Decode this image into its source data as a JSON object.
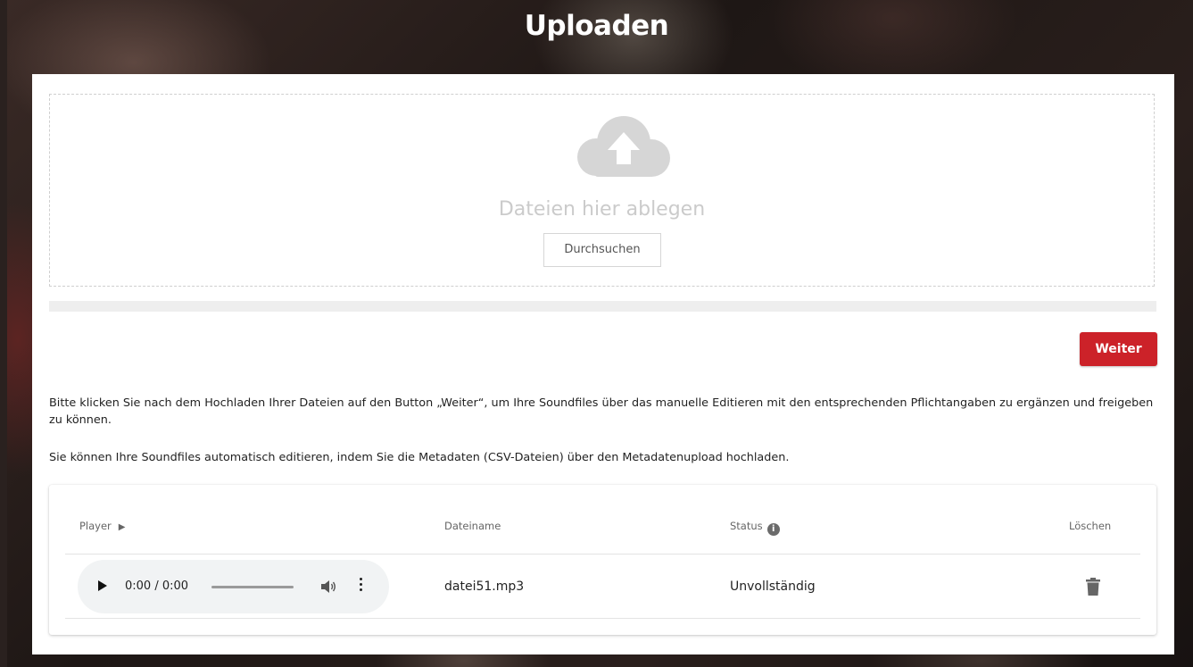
{
  "page": {
    "title": "Uploaden"
  },
  "dropzone": {
    "icon": "cloud-upload-icon",
    "text": "Dateien hier ablegen",
    "browse_label": "Durchsuchen"
  },
  "upload_progress": 0,
  "actions": {
    "next_label": "Weiter"
  },
  "info": {
    "paragraph_1": "Bitte klicken Sie nach dem Hochladen Ihrer Dateien auf den Button „Weiter“, um Ihre Soundfiles über das manuelle Editieren mit den entsprechenden Pflichtangaben zu ergänzen und freigeben zu können.",
    "paragraph_2": "Sie können Ihre Soundfiles automatisch editieren, indem Sie die Metadaten (CSV-Dateien) über den Metadatenupload hochladen."
  },
  "table": {
    "headers": {
      "player": "Player",
      "player_icon": "play-icon",
      "filename": "Dateiname",
      "status": "Status",
      "status_icon": "info-icon",
      "delete": "Löschen"
    },
    "rows": [
      {
        "player_time": "0:00 / 0:00",
        "filename": "datei51.mp3",
        "status": "Unvollständig",
        "delete_icon": "trash-icon"
      }
    ]
  },
  "colors": {
    "accent": "#cc2229",
    "dropzone_text": "#cbcbcb",
    "cloud_icon": "#d6d6d6",
    "player_bg": "#f1f3f4"
  }
}
